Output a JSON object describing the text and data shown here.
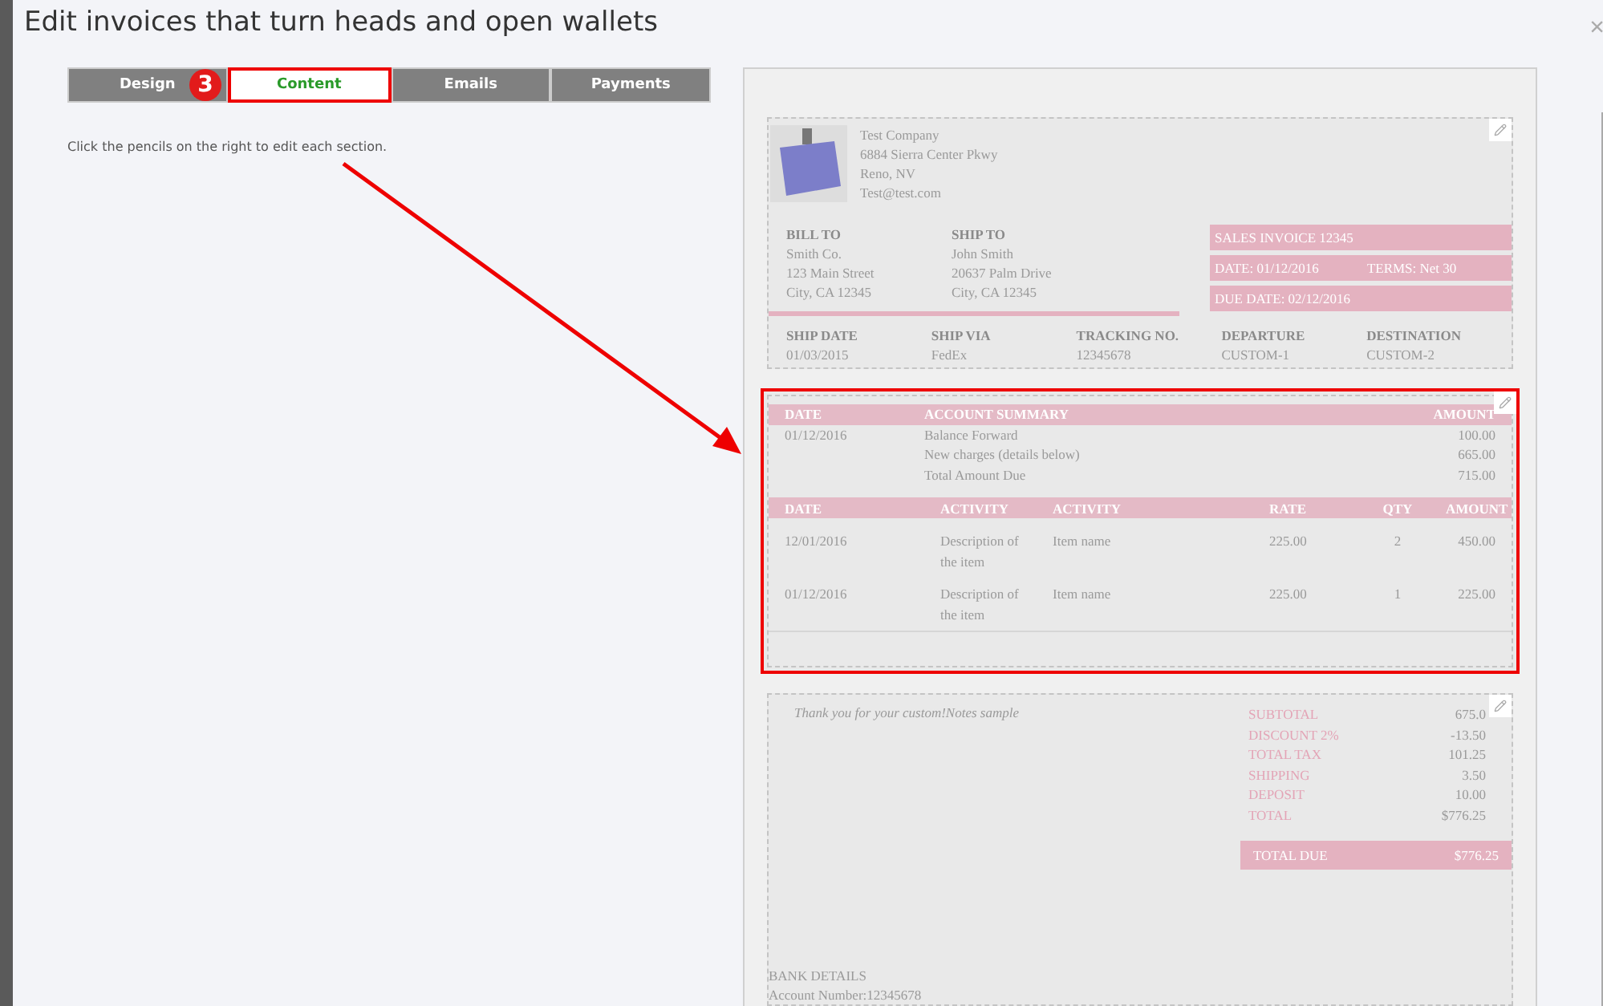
{
  "window": {
    "title": "Edit invoices that turn heads and open wallets",
    "close": "×"
  },
  "tabs": [
    {
      "label": "Design",
      "selected": false,
      "highlighted": false
    },
    {
      "label": "Content",
      "selected": true,
      "highlighted": true
    },
    {
      "label": "Emails",
      "selected": false,
      "highlighted": false
    },
    {
      "label": "Payments",
      "selected": false,
      "highlighted": false
    }
  ],
  "step_badge": "3",
  "instruction": "Click the pencils on the right to edit each section.",
  "invoice": {
    "header_section": {
      "highlighted": false,
      "company": [
        "Test Company",
        "6884 Sierra Center Pkwy",
        "Reno, NV",
        "Test@test.com"
      ],
      "bill_to": {
        "heading": "BILL TO",
        "lines": [
          "Smith Co.",
          "123 Main Street",
          "City, CA 12345"
        ]
      },
      "ship_to": {
        "heading": "SHIP TO",
        "lines": [
          "John Smith",
          "20637 Palm Drive",
          "City, CA 12345"
        ]
      },
      "invoice_boxes": [
        {
          "label": "SALES INVOICE  12345"
        },
        {
          "label": "DATE:  01/12/2016",
          "extra": "TERMS: Net 30"
        },
        {
          "label": "DUE DATE: 02/12/2016"
        }
      ],
      "shipping": [
        {
          "heading": "SHIP DATE",
          "value": "01/03/2015"
        },
        {
          "heading": "SHIP VIA",
          "value": "FedEx"
        },
        {
          "heading": "TRACKING NO.",
          "value": "12345678"
        },
        {
          "heading": "DEPARTURE",
          "value": "CUSTOM-1"
        },
        {
          "heading": "DESTINATION",
          "value": "CUSTOM-2"
        }
      ]
    },
    "summary_section": {
      "highlighted": true,
      "summary_headers": [
        "DATE",
        "ACCOUNT SUMMARY",
        "AMOUNT"
      ],
      "summary_rows": [
        [
          "01/12/2016",
          "Balance Forward",
          "100.00"
        ],
        [
          "",
          "New charges (details below)",
          "665.00"
        ],
        [
          "",
          "Total Amount Due",
          "715.00"
        ]
      ],
      "activity_headers": [
        "DATE",
        "ACTIVITY",
        "ACTIVITY",
        "RATE",
        "QTY",
        "AMOUNT"
      ],
      "activity_rows": [
        [
          "12/01/2016",
          "Description of the item",
          "Item name",
          "225.00",
          "2",
          "450.00"
        ],
        [
          "01/12/2016",
          "Description of the item",
          "Item name",
          "225.00",
          "1",
          "225.00"
        ]
      ]
    },
    "footer_section": {
      "highlighted": false,
      "notes": "Thank you for your custom!Notes sample",
      "totals": [
        {
          "label": "SUBTOTAL",
          "value": "675.0"
        },
        {
          "label": "DISCOUNT 2%",
          "value": "-13.50"
        },
        {
          "label": "TOTAL TAX",
          "value": "101.25"
        },
        {
          "label": "SHIPPING",
          "value": "3.50"
        },
        {
          "label": "DEPOSIT",
          "value": "10.00"
        },
        {
          "label": "TOTAL",
          "value": "$776.25"
        }
      ],
      "total_due": {
        "label": "TOTAL DUE",
        "value": "$776.25"
      },
      "bank": [
        "BANK DETAILS",
        "Account Number:12345678"
      ]
    }
  }
}
